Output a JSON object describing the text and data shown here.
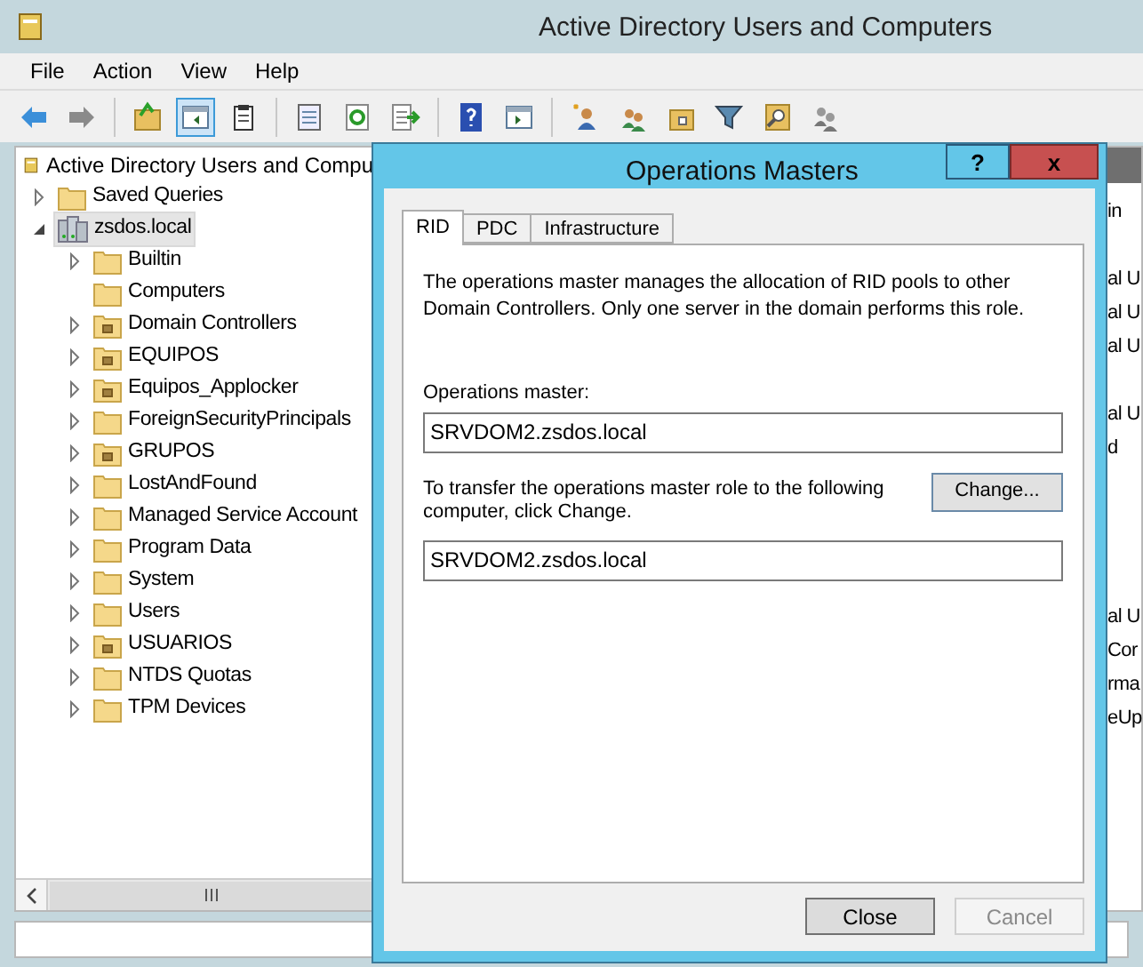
{
  "window": {
    "title": "Active Directory Users and Computers"
  },
  "menu": [
    "File",
    "Action",
    "View",
    "Help"
  ],
  "toolbar": [
    {
      "kind": "back",
      "pressed": false
    },
    {
      "kind": "forward",
      "pressed": false
    },
    {
      "kind": "separator"
    },
    {
      "kind": "folder-up",
      "pressed": false
    },
    {
      "kind": "console-tree",
      "pressed": true
    },
    {
      "kind": "clipboard",
      "pressed": false
    },
    {
      "kind": "separator"
    },
    {
      "kind": "properties",
      "pressed": false
    },
    {
      "kind": "refresh",
      "pressed": false
    },
    {
      "kind": "export",
      "pressed": false
    },
    {
      "kind": "separator"
    },
    {
      "kind": "help",
      "pressed": false
    },
    {
      "kind": "action-pane",
      "pressed": false
    },
    {
      "kind": "separator"
    },
    {
      "kind": "new-user",
      "pressed": false
    },
    {
      "kind": "new-group",
      "pressed": false
    },
    {
      "kind": "new-ou",
      "pressed": false
    },
    {
      "kind": "filter",
      "pressed": false
    },
    {
      "kind": "find",
      "pressed": false
    },
    {
      "kind": "delegate",
      "pressed": false
    }
  ],
  "tree": {
    "label": "Active Directory Users and Compu",
    "children": [
      {
        "label": "Saved Queries",
        "kind": "folder",
        "expanded": false,
        "selected": false
      },
      {
        "label": "zsdos.local",
        "kind": "domain",
        "expanded": true,
        "selected": true,
        "children": [
          {
            "label": "Builtin",
            "kind": "folder",
            "expanded": false,
            "selected": false
          },
          {
            "label": "Computers",
            "kind": "folder",
            "selected": false
          },
          {
            "label": "Domain Controllers",
            "kind": "ou",
            "expanded": false,
            "selected": false
          },
          {
            "label": "EQUIPOS",
            "kind": "ou",
            "expanded": false,
            "selected": false
          },
          {
            "label": "Equipos_Applocker",
            "kind": "ou",
            "expanded": false,
            "selected": false
          },
          {
            "label": "ForeignSecurityPrincipals",
            "kind": "folder",
            "expanded": false,
            "selected": false
          },
          {
            "label": "GRUPOS",
            "kind": "ou",
            "expanded": false,
            "selected": false
          },
          {
            "label": "LostAndFound",
            "kind": "folder",
            "expanded": false,
            "selected": false
          },
          {
            "label": "Managed Service Account",
            "kind": "folder",
            "expanded": false,
            "selected": false
          },
          {
            "label": "Program Data",
            "kind": "folder",
            "expanded": false,
            "selected": false
          },
          {
            "label": "System",
            "kind": "folder",
            "expanded": false,
            "selected": false
          },
          {
            "label": "Users",
            "kind": "folder",
            "expanded": false,
            "selected": false
          },
          {
            "label": "USUARIOS",
            "kind": "ou",
            "expanded": false,
            "selected": false
          },
          {
            "label": "NTDS Quotas",
            "kind": "folder",
            "expanded": false,
            "selected": false
          },
          {
            "label": "TPM Devices",
            "kind": "folder",
            "expanded": false,
            "selected": false
          }
        ]
      }
    ]
  },
  "right_pane": {
    "rows": [
      "in",
      "",
      "al U",
      "al U",
      "al U",
      "",
      "al U",
      "d",
      "",
      "",
      "",
      "",
      "al U",
      "Cor",
      "rma",
      "eUp"
    ]
  },
  "dialog": {
    "title": "Operations Masters",
    "help_button": "?",
    "close_button": "x",
    "tabs": [
      {
        "label": "RID",
        "selected": true
      },
      {
        "label": "PDC",
        "selected": false
      },
      {
        "label": "Infrastructure",
        "selected": false
      }
    ],
    "description": "The operations master manages the allocation of RID pools to other Domain Controllers. Only one server in the domain performs this role.",
    "operations_master_label": "Operations master:",
    "operations_master_value": "SRVDOM2.zsdos.local",
    "transfer_text": "To transfer the operations master role to the following computer, click Change.",
    "change_button": "Change...",
    "transfer_value": "SRVDOM2.zsdos.local",
    "buttons": [
      {
        "label": "Close",
        "disabled": false
      },
      {
        "label": "Cancel",
        "disabled": true
      }
    ]
  }
}
